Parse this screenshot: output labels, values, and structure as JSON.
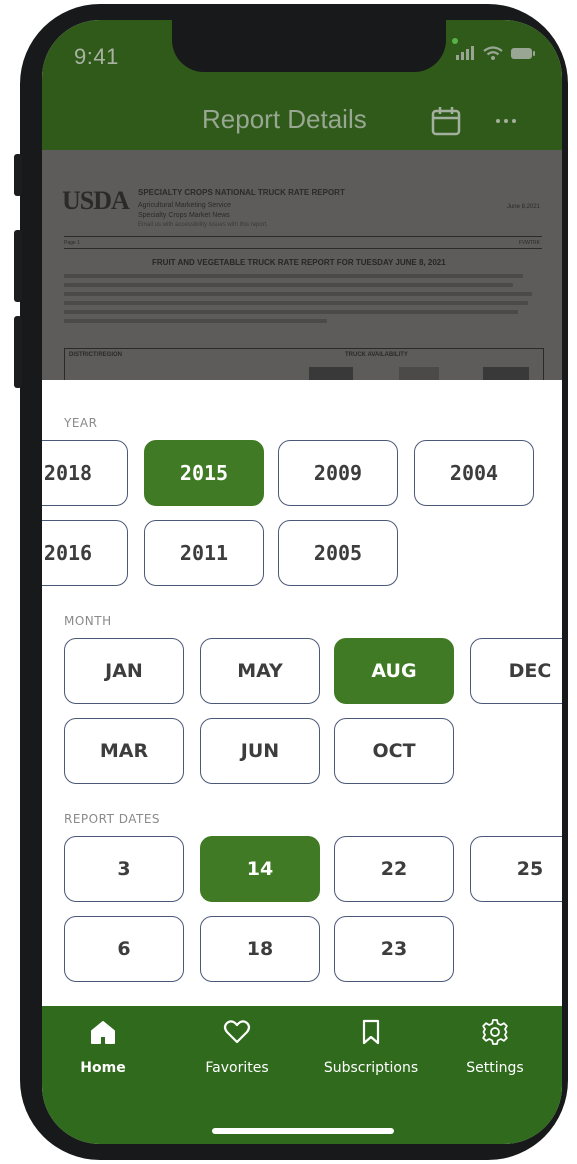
{
  "status_bar": {
    "time": "9:41"
  },
  "header": {
    "title": "Report Details",
    "calendar_icon": "calendar-icon",
    "more_icon": "more-horizontal-icon"
  },
  "document": {
    "logo": "USDA",
    "header_lines": [
      "SPECIALTY CROPS NATIONAL TRUCK RATE REPORT",
      "Agricultural Marketing Service",
      "Specialty Crops Market News",
      "Email us with accessibility issues with this report."
    ],
    "date": "June 8,2021",
    "page": "Page 1",
    "code": "FVWTRK",
    "title": "FRUIT AND VEGETABLE TRUCK RATE REPORT FOR TUESDAY JUNE 8, 2021",
    "table_headers": [
      "DISTRICT/REGION",
      "TRUCK AVAILABILITY"
    ]
  },
  "year": {
    "label": "YEAR",
    "options": [
      "2018",
      "2015",
      "2009",
      "2004",
      "2016",
      "2011",
      "2005"
    ],
    "selected": "2015"
  },
  "month": {
    "label": "MONTH",
    "options": [
      "JAN",
      "MAY",
      "AUG",
      "DEC",
      "MAR",
      "JUN",
      "OCT"
    ],
    "selected": "AUG"
  },
  "report_dates": {
    "label": "REPORT DATES",
    "options": [
      "3",
      "14",
      "22",
      "25",
      "6",
      "18",
      "23"
    ],
    "selected": "14"
  },
  "tabbar": {
    "items": [
      {
        "label": "Home",
        "icon": "home-icon",
        "active": true
      },
      {
        "label": "Favorites",
        "icon": "heart-icon",
        "active": false
      },
      {
        "label": "Subscriptions",
        "icon": "bookmark-icon",
        "active": false
      },
      {
        "label": "Settings",
        "icon": "gear-icon",
        "active": false
      }
    ]
  },
  "colors": {
    "brand_green": "#2f6a1d",
    "selected_chip": "#407a24",
    "chip_border": "#4c5878"
  }
}
